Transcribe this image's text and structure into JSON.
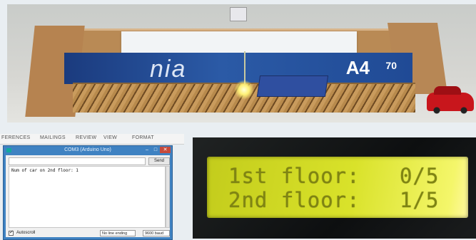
{
  "photo": {
    "box_brand_text": "nia",
    "paper_size": "A4",
    "paper_weight": "70"
  },
  "word_ribbon": {
    "tabs": [
      "FERENCES",
      "MAILINGS",
      "REVIEW",
      "VIEW",
      "FORMAT"
    ]
  },
  "serial_monitor": {
    "title": "COM3 (Arduino Uno)",
    "send_label": "Send",
    "input_value": "",
    "output_lines": [
      "Num of car on 2nd floor: 1"
    ],
    "autoscroll_label": "Autoscroll",
    "autoscroll_checked": true,
    "line_ending": "No line ending",
    "baud_rate": "9600 baud"
  },
  "lcd": {
    "line1": "1st floor:   0/5",
    "line2": "2nd floor:   1/5",
    "backlight_color": "#d9e22a",
    "text_color": "#7f8413"
  }
}
